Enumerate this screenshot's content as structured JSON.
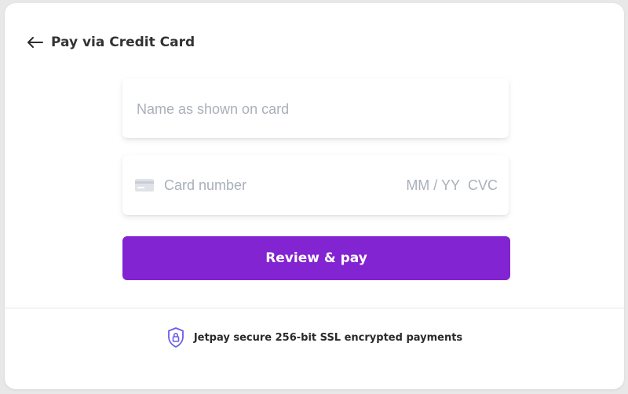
{
  "header": {
    "title": "Pay via Credit Card",
    "back_icon": "arrow-left-icon"
  },
  "form": {
    "name_placeholder": "Name as shown on card",
    "card_number_placeholder": "Card number",
    "expiry_placeholder": "MM / YY",
    "cvc_placeholder": "CVC",
    "card_icon": "credit-card-icon"
  },
  "actions": {
    "pay_label": "Review & pay"
  },
  "footer": {
    "secure_text": "Jetpay secure 256-bit SSL encrypted payments",
    "secure_icon": "shield-lock-icon"
  },
  "colors": {
    "accent": "#8224d1",
    "shield": "#6b5ce7"
  }
}
